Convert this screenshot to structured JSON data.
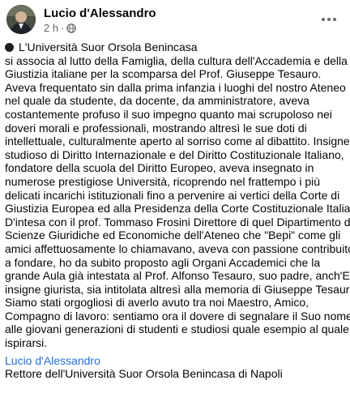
{
  "header": {
    "author": "Lucio d'Alessandro",
    "time": "2 h",
    "separator": "·",
    "audience_icon": "globe-icon",
    "more_icon": "more-horizontal-icon"
  },
  "post": {
    "opening_icon": "black-circle-icon",
    "lines": [
      "L'Università Suor Orsola Benincasa",
      "si associa al lutto della Famiglia, della cultura dell'Accademia e della",
      "Giustizia italiane per la scomparsa del Prof. Giuseppe Tesauro.",
      "Aveva frequentato sin dalla prima infanzia i luoghi del nostro Ateneo",
      "nel quale da studente, da docente, da amministratore, aveva",
      "costantemente profuso il suo impegno quanto mai scrupoloso nei",
      "doveri morali e professionali, mostrando altresì le sue doti di",
      "intellettuale, culturalmente aperto al sorriso come al dibattito. Insigne",
      "studioso di Diritto Internazionale e del Diritto Costituzionale Italiano,",
      "fondatore della scuola del Diritto Europeo, aveva insegnato in",
      "numerose  prestigiose Università, ricoprendo nel frattempo i più",
      "delicati incarichi istituzionali fino a pervenire ai vertici della Corte di",
      "Giustizia Europea ed alla Presidenza della Corte Costituzionale Italiana.",
      "D'intesa con il prof. Tommaso Frosini Direttore di quel Dipartimento di",
      "Scienze Giuridiche ed Economiche dell'Ateneo che \"Bepi\" come gli",
      "amici affettuosamente lo chiamavano, aveva con passione contribuito",
      "a fondare, ho da subito proposto agli Organi Accademici che  la",
      "grande Aula già intestata al Prof. Alfonso Tesauro, suo padre, anch'Egli",
      "insigne giurista, sia intitolata altresì alla memoria di Giuseppe Tesauro.",
      " Siamo stati orgogliosi di averlo avuto tra noi Maestro, Amico,",
      "Compagno di lavoro: sentiamo ora il dovere di segnalare il Suo nome",
      "alle giovani generazioni di studenti e studiosi quale esempio al quale",
      "ispirarsi."
    ],
    "signature_name": "Lucio d'Alessandro",
    "signature_role": "Rettore dell'Università Suor Orsola Benincasa di Napoli"
  },
  "colors": {
    "text": "#050505",
    "meta": "#65676b",
    "link": "#216fdb"
  }
}
